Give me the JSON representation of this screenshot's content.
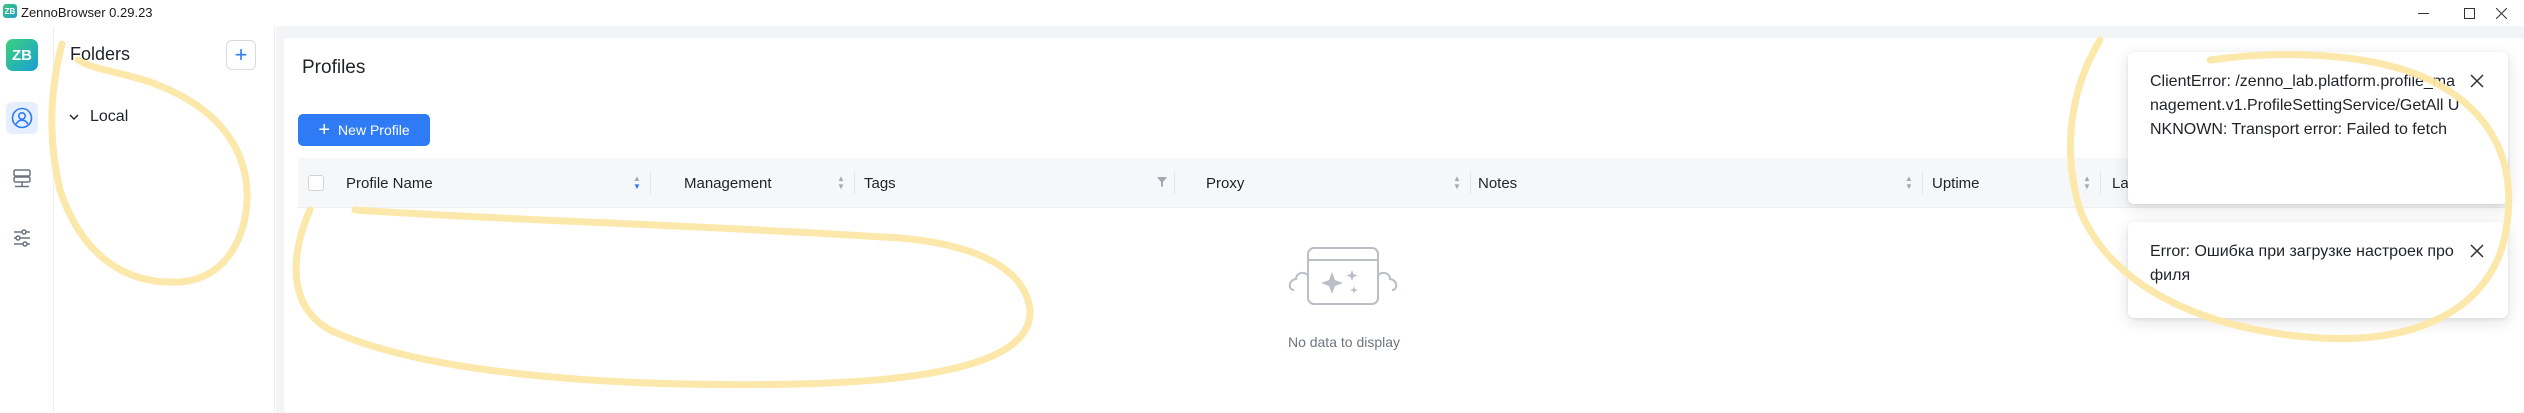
{
  "window": {
    "app_icon_text": "ZB",
    "title": "ZennoBrowser 0.29.23"
  },
  "rail": {
    "logo_text": "ZB",
    "items": [
      {
        "name": "profiles",
        "icon": "user-circle-icon",
        "active": true
      },
      {
        "name": "network",
        "icon": "network-icon",
        "active": false
      },
      {
        "name": "settings",
        "icon": "sliders-icon",
        "active": false
      }
    ]
  },
  "folders": {
    "title": "Folders",
    "add_label": "+",
    "items": [
      {
        "label": "Local",
        "icon": "chevron-down-icon"
      }
    ]
  },
  "main": {
    "title": "Profiles",
    "new_profile_label": "New Profile",
    "columns": [
      {
        "label": "Profile Name",
        "sort": "desc"
      },
      {
        "label": "Management",
        "sort": "none"
      },
      {
        "label": "Tags",
        "filter": true
      },
      {
        "label": "Proxy",
        "sort": "none"
      },
      {
        "label": "Notes",
        "sort": "none"
      },
      {
        "label": "Uptime",
        "sort": "none"
      },
      {
        "label": "La",
        "sort": "none"
      }
    ],
    "empty_text": "No data to display"
  },
  "notifications": [
    {
      "message": "ClientError: /zenno_lab.platform.profile_management.v1.ProfileSettingService/GetAll UNKNOWN: Transport error: Failed to fetch"
    },
    {
      "message": "Error: Ошибка при загрузке настроек профиля"
    }
  ],
  "colors": {
    "accent": "#2f7bf5",
    "annotation": "#fce7a6",
    "main_bg": "#f3f4f6"
  }
}
